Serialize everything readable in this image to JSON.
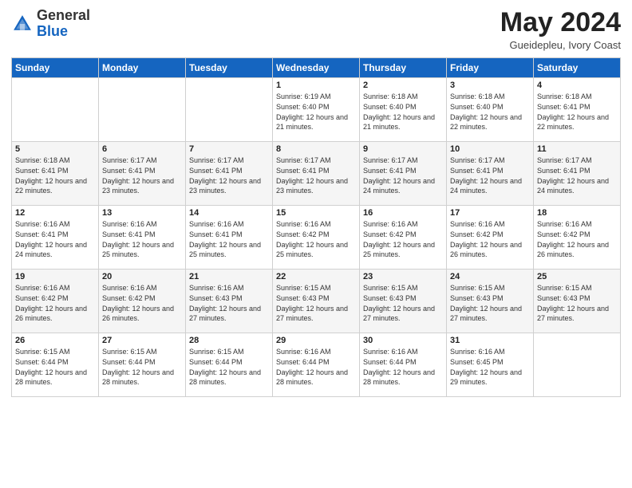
{
  "header": {
    "logo_general": "General",
    "logo_blue": "Blue",
    "month_title": "May 2024",
    "subtitle": "Gueidepleu, Ivory Coast"
  },
  "weekdays": [
    "Sunday",
    "Monday",
    "Tuesday",
    "Wednesday",
    "Thursday",
    "Friday",
    "Saturday"
  ],
  "weeks": [
    [
      {
        "day": "",
        "sunrise": "",
        "sunset": "",
        "daylight": ""
      },
      {
        "day": "",
        "sunrise": "",
        "sunset": "",
        "daylight": ""
      },
      {
        "day": "",
        "sunrise": "",
        "sunset": "",
        "daylight": ""
      },
      {
        "day": "1",
        "sunrise": "Sunrise: 6:19 AM",
        "sunset": "Sunset: 6:40 PM",
        "daylight": "Daylight: 12 hours and 21 minutes."
      },
      {
        "day": "2",
        "sunrise": "Sunrise: 6:18 AM",
        "sunset": "Sunset: 6:40 PM",
        "daylight": "Daylight: 12 hours and 21 minutes."
      },
      {
        "day": "3",
        "sunrise": "Sunrise: 6:18 AM",
        "sunset": "Sunset: 6:40 PM",
        "daylight": "Daylight: 12 hours and 22 minutes."
      },
      {
        "day": "4",
        "sunrise": "Sunrise: 6:18 AM",
        "sunset": "Sunset: 6:41 PM",
        "daylight": "Daylight: 12 hours and 22 minutes."
      }
    ],
    [
      {
        "day": "5",
        "sunrise": "Sunrise: 6:18 AM",
        "sunset": "Sunset: 6:41 PM",
        "daylight": "Daylight: 12 hours and 22 minutes."
      },
      {
        "day": "6",
        "sunrise": "Sunrise: 6:17 AM",
        "sunset": "Sunset: 6:41 PM",
        "daylight": "Daylight: 12 hours and 23 minutes."
      },
      {
        "day": "7",
        "sunrise": "Sunrise: 6:17 AM",
        "sunset": "Sunset: 6:41 PM",
        "daylight": "Daylight: 12 hours and 23 minutes."
      },
      {
        "day": "8",
        "sunrise": "Sunrise: 6:17 AM",
        "sunset": "Sunset: 6:41 PM",
        "daylight": "Daylight: 12 hours and 23 minutes."
      },
      {
        "day": "9",
        "sunrise": "Sunrise: 6:17 AM",
        "sunset": "Sunset: 6:41 PM",
        "daylight": "Daylight: 12 hours and 24 minutes."
      },
      {
        "day": "10",
        "sunrise": "Sunrise: 6:17 AM",
        "sunset": "Sunset: 6:41 PM",
        "daylight": "Daylight: 12 hours and 24 minutes."
      },
      {
        "day": "11",
        "sunrise": "Sunrise: 6:17 AM",
        "sunset": "Sunset: 6:41 PM",
        "daylight": "Daylight: 12 hours and 24 minutes."
      }
    ],
    [
      {
        "day": "12",
        "sunrise": "Sunrise: 6:16 AM",
        "sunset": "Sunset: 6:41 PM",
        "daylight": "Daylight: 12 hours and 24 minutes."
      },
      {
        "day": "13",
        "sunrise": "Sunrise: 6:16 AM",
        "sunset": "Sunset: 6:41 PM",
        "daylight": "Daylight: 12 hours and 25 minutes."
      },
      {
        "day": "14",
        "sunrise": "Sunrise: 6:16 AM",
        "sunset": "Sunset: 6:41 PM",
        "daylight": "Daylight: 12 hours and 25 minutes."
      },
      {
        "day": "15",
        "sunrise": "Sunrise: 6:16 AM",
        "sunset": "Sunset: 6:42 PM",
        "daylight": "Daylight: 12 hours and 25 minutes."
      },
      {
        "day": "16",
        "sunrise": "Sunrise: 6:16 AM",
        "sunset": "Sunset: 6:42 PM",
        "daylight": "Daylight: 12 hours and 25 minutes."
      },
      {
        "day": "17",
        "sunrise": "Sunrise: 6:16 AM",
        "sunset": "Sunset: 6:42 PM",
        "daylight": "Daylight: 12 hours and 26 minutes."
      },
      {
        "day": "18",
        "sunrise": "Sunrise: 6:16 AM",
        "sunset": "Sunset: 6:42 PM",
        "daylight": "Daylight: 12 hours and 26 minutes."
      }
    ],
    [
      {
        "day": "19",
        "sunrise": "Sunrise: 6:16 AM",
        "sunset": "Sunset: 6:42 PM",
        "daylight": "Daylight: 12 hours and 26 minutes."
      },
      {
        "day": "20",
        "sunrise": "Sunrise: 6:16 AM",
        "sunset": "Sunset: 6:42 PM",
        "daylight": "Daylight: 12 hours and 26 minutes."
      },
      {
        "day": "21",
        "sunrise": "Sunrise: 6:16 AM",
        "sunset": "Sunset: 6:43 PM",
        "daylight": "Daylight: 12 hours and 27 minutes."
      },
      {
        "day": "22",
        "sunrise": "Sunrise: 6:15 AM",
        "sunset": "Sunset: 6:43 PM",
        "daylight": "Daylight: 12 hours and 27 minutes."
      },
      {
        "day": "23",
        "sunrise": "Sunrise: 6:15 AM",
        "sunset": "Sunset: 6:43 PM",
        "daylight": "Daylight: 12 hours and 27 minutes."
      },
      {
        "day": "24",
        "sunrise": "Sunrise: 6:15 AM",
        "sunset": "Sunset: 6:43 PM",
        "daylight": "Daylight: 12 hours and 27 minutes."
      },
      {
        "day": "25",
        "sunrise": "Sunrise: 6:15 AM",
        "sunset": "Sunset: 6:43 PM",
        "daylight": "Daylight: 12 hours and 27 minutes."
      }
    ],
    [
      {
        "day": "26",
        "sunrise": "Sunrise: 6:15 AM",
        "sunset": "Sunset: 6:44 PM",
        "daylight": "Daylight: 12 hours and 28 minutes."
      },
      {
        "day": "27",
        "sunrise": "Sunrise: 6:15 AM",
        "sunset": "Sunset: 6:44 PM",
        "daylight": "Daylight: 12 hours and 28 minutes."
      },
      {
        "day": "28",
        "sunrise": "Sunrise: 6:15 AM",
        "sunset": "Sunset: 6:44 PM",
        "daylight": "Daylight: 12 hours and 28 minutes."
      },
      {
        "day": "29",
        "sunrise": "Sunrise: 6:16 AM",
        "sunset": "Sunset: 6:44 PM",
        "daylight": "Daylight: 12 hours and 28 minutes."
      },
      {
        "day": "30",
        "sunrise": "Sunrise: 6:16 AM",
        "sunset": "Sunset: 6:44 PM",
        "daylight": "Daylight: 12 hours and 28 minutes."
      },
      {
        "day": "31",
        "sunrise": "Sunrise: 6:16 AM",
        "sunset": "Sunset: 6:45 PM",
        "daylight": "Daylight: 12 hours and 29 minutes."
      },
      {
        "day": "",
        "sunrise": "",
        "sunset": "",
        "daylight": ""
      }
    ]
  ]
}
